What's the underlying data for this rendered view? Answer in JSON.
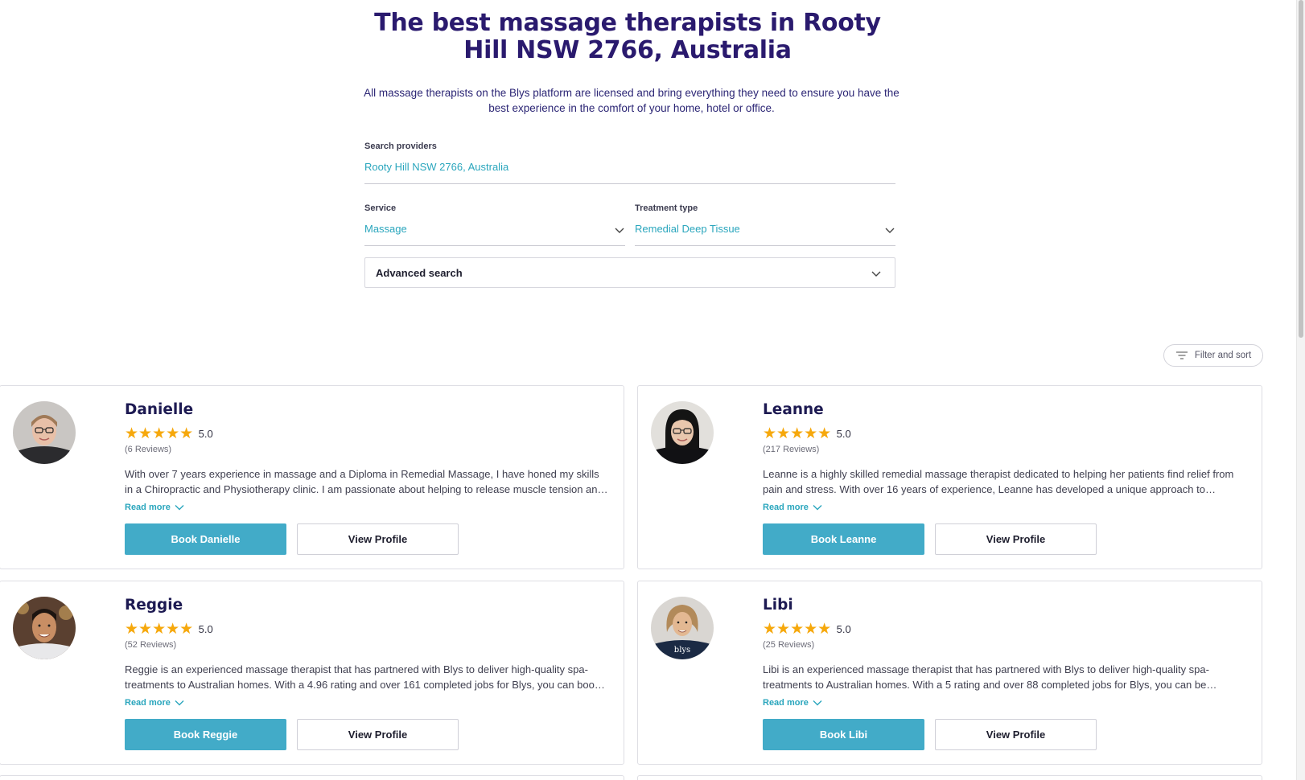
{
  "hero": {
    "title": "The best massage therapists in Rooty Hill NSW 2766, Australia",
    "subtitle": "All massage therapists on the Blys platform are licensed and bring everything they need to ensure you have the best experience in the comfort of your home, hotel or office."
  },
  "search": {
    "providers_label": "Search providers",
    "providers_value": "Rooty Hill NSW 2766, Australia",
    "service_label": "Service",
    "service_value": "Massage",
    "treatment_label": "Treatment type",
    "treatment_value": "Remedial Deep Tissue",
    "advanced_label": "Advanced search"
  },
  "filter": {
    "label": "Filter and sort",
    "icon": "filter-lines-icon"
  },
  "colors": {
    "title": "#2a1a6e",
    "accent": "#2aa6bd",
    "button": "#42abc8",
    "star": "#f6a80c"
  },
  "providers": [
    {
      "name": "Danielle",
      "stars": "★★★★★",
      "rating": "5.0",
      "reviews": "(6 Reviews)",
      "description": "With over 7 years experience in massage and a Diploma in Remedial Massage, I have honed my skills in a Chiropractic and Physiotherapy clinic. I am passionate about helping to release muscle tension and improve mobility.",
      "read_more": "Read more",
      "book_label": "Book Danielle",
      "view_label": "View Profile"
    },
    {
      "name": "Leanne",
      "stars": "★★★★★",
      "rating": "5.0",
      "reviews": "(217 Reviews)",
      "description": "Leanne is a highly skilled remedial massage therapist dedicated to helping her patients find relief from pain and stress. With over 16 years of experience, Leanne has developed a unique approach to treatment.",
      "read_more": "Read more",
      "book_label": "Book Leanne",
      "view_label": "View Profile"
    },
    {
      "name": "Reggie",
      "stars": "★★★★★",
      "rating": "5.0",
      "reviews": "(52 Reviews)",
      "description": "Reggie is an experienced massage therapist that has partnered with Blys to deliver high-quality spa-treatments to Australian homes. With a 4.96 rating and over 161 completed jobs for Blys, you can book with confidence.",
      "read_more": "Read more",
      "book_label": "Book Reggie",
      "view_label": "View Profile"
    },
    {
      "name": "Libi",
      "stars": "★★★★★",
      "rating": "5.0",
      "reviews": "(25 Reviews)",
      "description": "Libi is an experienced massage therapist that has partnered with Blys to deliver high-quality spa-treatments to Australian homes. With a 5 rating and over 88 completed jobs for Blys, you can be confident in your booking.",
      "read_more": "Read more",
      "book_label": "Book Libi",
      "view_label": "View Profile",
      "shirt_text": "blys"
    }
  ]
}
